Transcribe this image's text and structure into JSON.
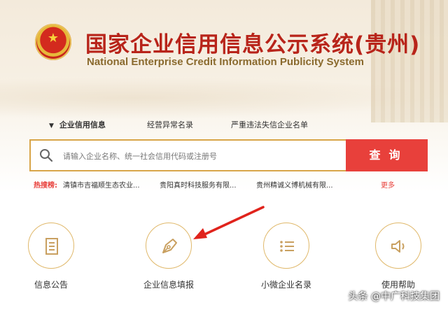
{
  "header": {
    "title": "国家企业信用信息公示系统(贵州)",
    "subtitle": "National Enterprise Credit Information Publicity System",
    "emblem_icon": "national-emblem"
  },
  "tabs": [
    {
      "label": "企业信用信息",
      "active": true
    },
    {
      "label": "经营异常名录",
      "active": false
    },
    {
      "label": "严重违法失信企业名单",
      "active": false
    }
  ],
  "search": {
    "placeholder": "请输入企业名称、统一社会信用代码或注册号",
    "button": "查询"
  },
  "hot_search": {
    "label": "热搜榜:",
    "items": [
      "清镇市吉福顺生态农业...",
      "贵阳真时科技服务有限...",
      "贵州精诚义博机械有限..."
    ],
    "more": "更多"
  },
  "features": [
    {
      "label": "信息公告",
      "icon": "document-icon"
    },
    {
      "label": "企业信息填报",
      "icon": "pen-nib-icon"
    },
    {
      "label": "小微企业名录",
      "icon": "list-icon"
    },
    {
      "label": "使用帮助",
      "icon": "speaker-icon"
    }
  ],
  "watermark": "头条 @中广科技集团",
  "colors": {
    "brand_red": "#b8241a",
    "button_red": "#e8403b",
    "gold": "#d8a548"
  }
}
